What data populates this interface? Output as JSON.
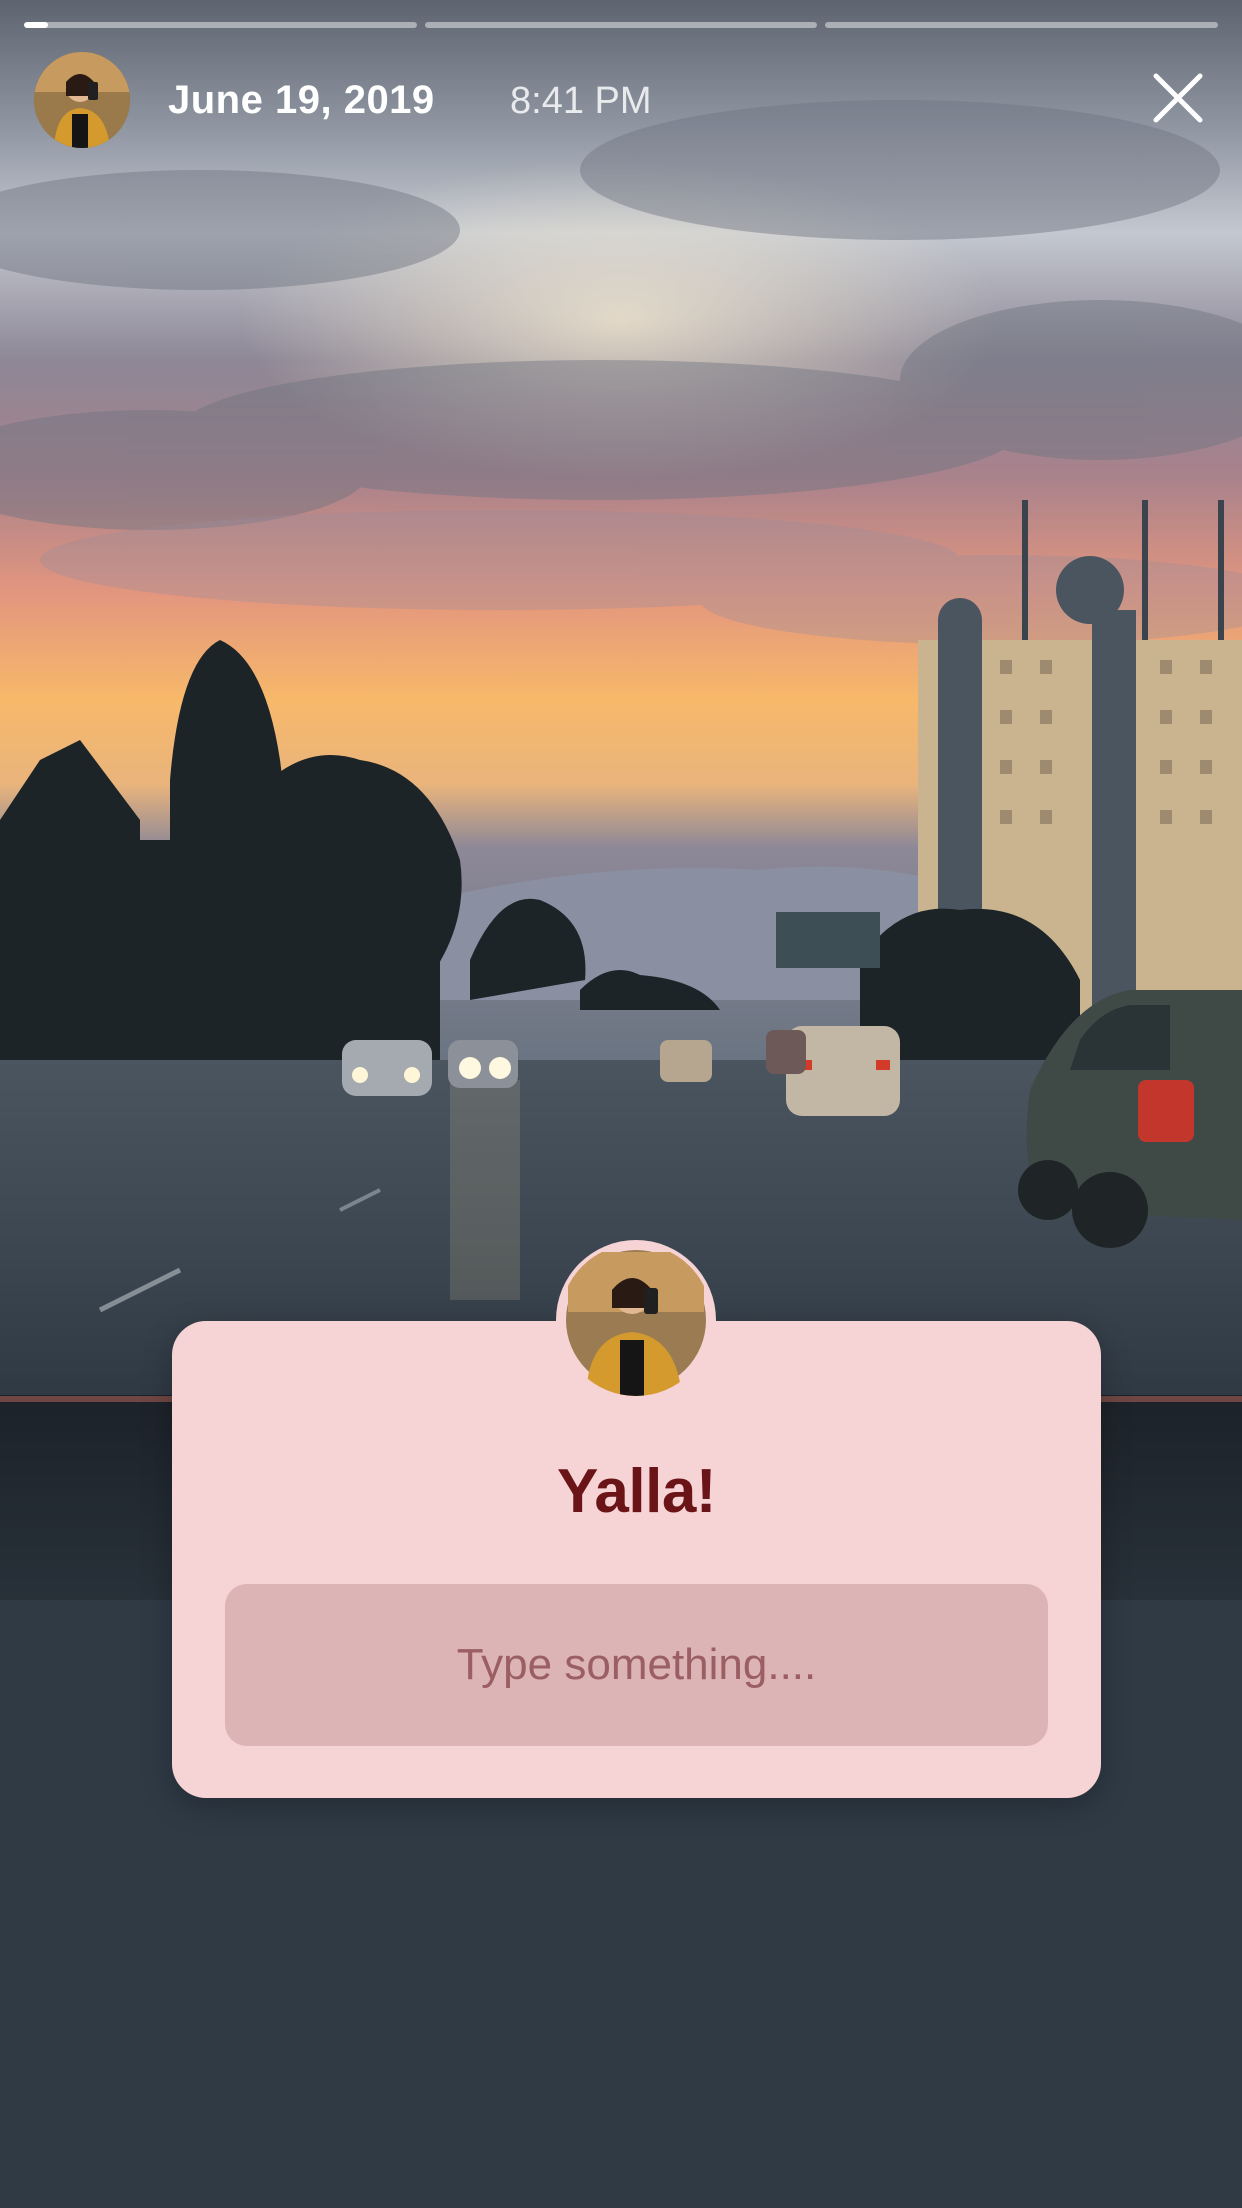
{
  "story": {
    "progress": [
      0.06,
      0,
      0
    ],
    "date": "June 19, 2019",
    "time": "8:41 PM"
  },
  "sticker": {
    "title": "Yalla!",
    "input_placeholder": "Type something....",
    "input_value": ""
  },
  "colors": {
    "card_bg": "#f6d3d5",
    "card_title": "#6a1418",
    "input_bg": "#dcb4b6",
    "sunset": "#f5a560"
  },
  "icons": {
    "close": "close-icon",
    "avatar": "avatar"
  }
}
